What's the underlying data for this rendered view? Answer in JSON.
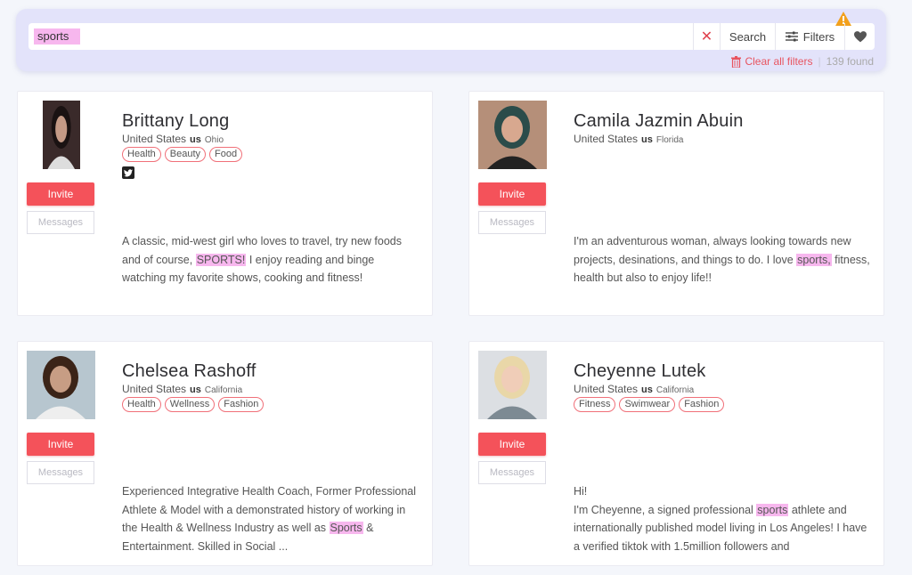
{
  "search": {
    "query": "sports",
    "search_label": "Search",
    "filters_label": "Filters",
    "clear_all_label": "Clear all filters",
    "found_label": "139 found"
  },
  "colors": {
    "accent": "#f4525a",
    "highlight": "#f7b7ee",
    "panel": "#e3e3fa"
  },
  "profiles": [
    {
      "name": "Brittany Long",
      "country": "United States",
      "country_code": "us",
      "state": "Ohio",
      "tags": [
        "Health",
        "Beauty",
        "Food"
      ],
      "social": [
        "twitter-icon"
      ],
      "invite_label": "Invite",
      "messages_label": "Messages",
      "bio_before": "A classic, mid-west girl who loves to travel, try new foods and of course, ",
      "bio_match": "SPORTS!",
      "bio_after": " I enjoy reading and binge watching my favorite shows, cooking and fitness!"
    },
    {
      "name": "Camila Jazmin Abuin",
      "country": "United States",
      "country_code": "us",
      "state": "Florida",
      "tags": [],
      "social": [],
      "invite_label": "Invite",
      "messages_label": "Messages",
      "bio_before": "I'm an adventurous woman, always looking towards new projects, desinations, and things to do. I love ",
      "bio_match": "sports,",
      "bio_after": " fitness, health but also to enjoy life!!"
    },
    {
      "name": "Chelsea Rashoff",
      "country": "United States",
      "country_code": "us",
      "state": "California",
      "tags": [
        "Health",
        "Wellness",
        "Fashion"
      ],
      "social": [],
      "invite_label": "Invite",
      "messages_label": "Messages",
      "bio_before": "Experienced Integrative Health Coach, Former Professional Athlete & Model with a demonstrated history of working in the Health & Wellness Industry as well as ",
      "bio_match": "Sports",
      "bio_after": " & Entertainment. Skilled in Social  ..."
    },
    {
      "name": "Cheyenne Lutek",
      "country": "United States",
      "country_code": "us",
      "state": "California",
      "tags": [
        "Fitness",
        "Swimwear",
        "Fashion"
      ],
      "social": [],
      "invite_label": "Invite",
      "messages_label": "Messages",
      "bio_before": "Hi!\nI'm Cheyenne, a signed professional ",
      "bio_match": "sports",
      "bio_after": " athlete and internationally published model living in Los Angeles! I have a verified tiktok with 1.5million followers and"
    }
  ]
}
